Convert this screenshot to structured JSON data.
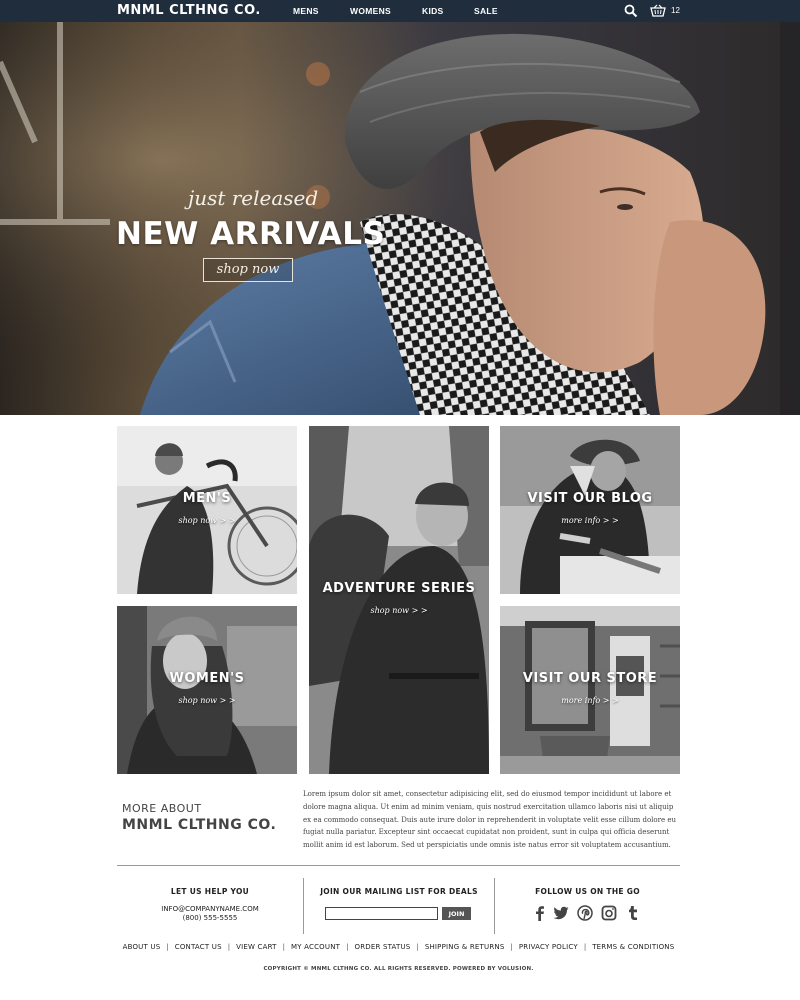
{
  "nav": {
    "logo": "MNML  CLTHNG CO.",
    "links": [
      "MENS",
      "WOMENS",
      "KIDS",
      "SALE"
    ],
    "cart_count": "12",
    "icons": [
      "search-icon",
      "cart-icon"
    ]
  },
  "hero": {
    "subtitle": "just released",
    "title": "NEW ARRIVALS",
    "button": "shop now"
  },
  "tiles": [
    {
      "title": "MEN'S",
      "link": "shop now > >"
    },
    {
      "title": "ADVENTURE SERIES",
      "link": "shop now > >"
    },
    {
      "title": "VISIT OUR BLOG",
      "link": "more info > >"
    },
    {
      "title": "WOMEN'S",
      "link": "shop now > >"
    },
    {
      "title": "VISIT OUR STORE",
      "link": "more info > >"
    }
  ],
  "about": {
    "pre": "MORE ABOUT",
    "title": "MNML  CLTHNG CO.",
    "text": "Lorem ipsum dolor sit amet, consectetur adipisicing elit, sed do eiusmod tempor incididunt ut labore et dolore magna aliqua. Ut enim ad minim veniam, quis nostrud exercitation ullamco laboris nisi ut aliquip ex ea commodo consequat. Duis aute irure dolor in reprehenderit in voluptate velit esse cillum dolore eu fugiat nulla pariatur. Excepteur sint occaecat cupidatat non proident, sunt in culpa qui officia deserunt mollit anim id est laborum. Sed ut perspiciatis unde omnis iste natus error sit voluptatem accusantium."
  },
  "footer": {
    "help_heading": "LET US HELP YOU",
    "help_email": "INFO@COMPANYNAME.COM",
    "help_phone": "(800) 555-5555",
    "mail_heading": "JOIN OUR MAILING LIST FOR DEALS",
    "mail_input_value": "",
    "mail_button": "JOIN",
    "social_heading": "FOLLOW US ON THE GO",
    "social_icons": [
      "facebook-icon",
      "twitter-icon",
      "pinterest-icon",
      "instagram-icon",
      "tumblr-icon"
    ],
    "links": [
      "ABOUT US",
      "CONTACT US",
      "VIEW CART",
      "MY ACCOUNT",
      "ORDER STATUS",
      "SHIPPING & RETURNS",
      "PRIVACY POLICY",
      "TERMS & CONDITIONS"
    ],
    "copyright": "COPYRIGHT © MNML CLTHNG CO.  ALL RIGHTS RESERVED. POWERED BY VOLUSION."
  },
  "colors": {
    "nav_bg": "#1f2d3d",
    "text_dark": "#333333",
    "button_dark": "#555555"
  }
}
